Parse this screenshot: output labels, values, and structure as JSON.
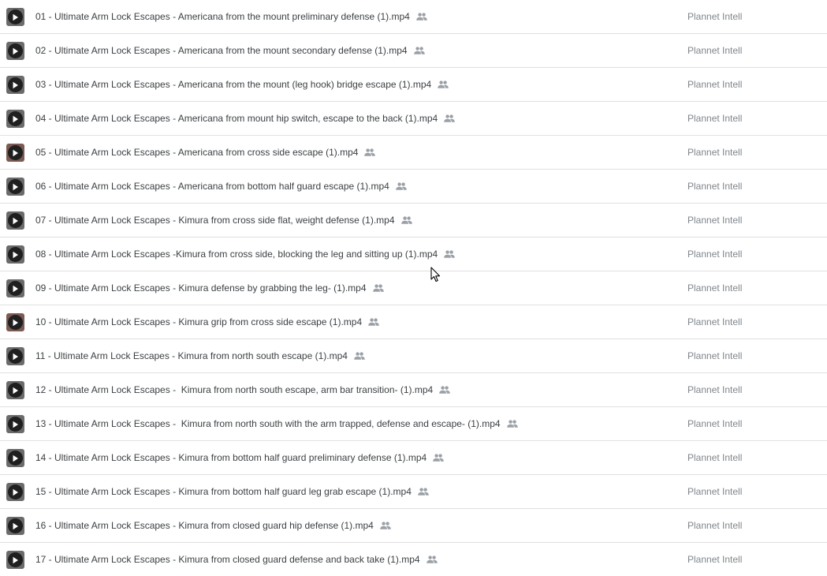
{
  "files": [
    {
      "name": "01 - Ultimate Arm Lock Escapes - Americana from the mount preliminary defense (1).mp4",
      "owner": "Plannet Intell",
      "icon": "video-file-icon",
      "shared": true
    },
    {
      "name": "02 - Ultimate Arm Lock Escapes - Americana from the mount secondary defense (1).mp4",
      "owner": "Plannet Intell",
      "icon": "video-file-icon",
      "shared": true
    },
    {
      "name": "03 - Ultimate Arm Lock Escapes - Americana from the mount (leg hook) bridge escape (1).mp4",
      "owner": "Plannet Intell",
      "icon": "video-file-icon",
      "shared": true
    },
    {
      "name": "04 - Ultimate Arm Lock Escapes - Americana from mount hip switch, escape to the back (1).mp4",
      "owner": "Plannet Intell",
      "icon": "video-file-icon",
      "shared": true
    },
    {
      "name": "05 - Ultimate Arm Lock Escapes - Americana from cross side escape (1).mp4",
      "owner": "Plannet Intell",
      "icon": "video-file-icon",
      "shared": true
    },
    {
      "name": "06 - Ultimate Arm Lock Escapes - Americana from bottom half guard escape (1).mp4",
      "owner": "Plannet Intell",
      "icon": "video-file-icon",
      "shared": true
    },
    {
      "name": "07 - Ultimate Arm Lock Escapes - Kimura from cross side flat, weight defense (1).mp4",
      "owner": "Plannet Intell",
      "icon": "video-file-icon",
      "shared": true
    },
    {
      "name": "08 - Ultimate Arm Lock Escapes -Kimura from cross side, blocking the leg and sitting up (1).mp4",
      "owner": "Plannet Intell",
      "icon": "video-file-icon",
      "shared": true
    },
    {
      "name": "09 - Ultimate Arm Lock Escapes - Kimura defense by grabbing the leg- (1).mp4",
      "owner": "Plannet Intell",
      "icon": "video-file-icon",
      "shared": true
    },
    {
      "name": "10 - Ultimate Arm Lock Escapes - Kimura grip from cross side escape (1).mp4",
      "owner": "Plannet Intell",
      "icon": "video-file-icon",
      "shared": true
    },
    {
      "name": "11 - Ultimate Arm Lock Escapes - Kimura from north south escape (1).mp4",
      "owner": "Plannet Intell",
      "icon": "video-file-icon",
      "shared": true
    },
    {
      "name": "12 - Ultimate Arm Lock Escapes -  Kimura from north south escape, arm bar transition- (1).mp4",
      "owner": "Plannet Intell",
      "icon": "video-file-icon",
      "shared": true
    },
    {
      "name": "13 - Ultimate Arm Lock Escapes -  Kimura from north south with the arm trapped, defense and escape- (1).mp4",
      "owner": "Plannet Intell",
      "icon": "video-file-icon",
      "shared": true
    },
    {
      "name": "14 - Ultimate Arm Lock Escapes - Kimura from bottom half guard preliminary defense (1).mp4",
      "owner": "Plannet Intell",
      "icon": "video-file-icon",
      "shared": true
    },
    {
      "name": "15 - Ultimate Arm Lock Escapes - Kimura from bottom half guard leg grab escape (1).mp4",
      "owner": "Plannet Intell",
      "icon": "video-file-icon",
      "shared": true
    },
    {
      "name": "16 - Ultimate Arm Lock Escapes - Kimura from closed guard hip defense (1).mp4",
      "owner": "Plannet Intell",
      "icon": "video-file-icon",
      "shared": true
    },
    {
      "name": "17 - Ultimate Arm Lock Escapes - Kimura from closed guard defense and back take (1).mp4",
      "owner": "Plannet Intell",
      "icon": "video-file-icon",
      "shared": true
    }
  ],
  "colors": {
    "text": "#3c4043",
    "owner_text": "#80868b",
    "divider": "#e0e0e0",
    "shared_icon": "#9aa0a6"
  }
}
